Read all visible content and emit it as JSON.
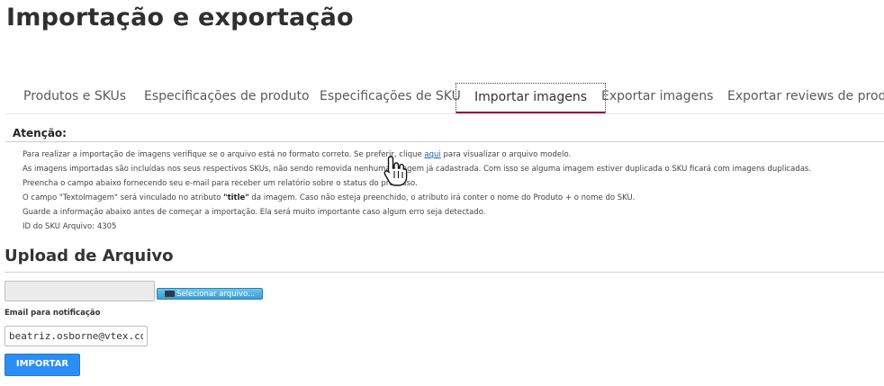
{
  "page": {
    "title": "Importação e exportação"
  },
  "tabs": [
    {
      "label": "Produtos e SKUs"
    },
    {
      "label": "Especificações de produto"
    },
    {
      "label": "Especificações de SKU"
    },
    {
      "label": "Importar imagens",
      "active": true
    },
    {
      "label": "Exportar imagens"
    },
    {
      "label": "Exportar reviews de produto"
    }
  ],
  "attention": {
    "title": "Atenção:",
    "line1_before": "Para realizar a importação de imagens verifique se o arquivo está no formato correto. Se preferir, clique ",
    "line1_link": "aqui",
    "line1_after": " para visualizar o arquivo modelo.",
    "line2": "As imagens importadas são incluídas nos seus respectivos SKUs, não sendo removida nenhuma imagem já cadastrada. Com isso se alguma imagem estiver duplicada o SKU ficará com imagens duplicadas.",
    "line3": "Preencha o campo abaixo fornecendo seu e-mail para receber um relatório sobre o status do processo.",
    "line4_before": "O campo \"TextoImagem\" será vinculado no atributo ",
    "line4_bold": "\"title\"",
    "line4_after": " da imagem. Caso não esteja preenchido, o atributo irá conter o nome do Produto + o nome do SKU.",
    "line5": "Guarde a informação abaixo antes de começar a importação. Ela será muito importante caso algum erro seja detectado.",
    "line6": "ID do SKU Arquivo: 4305"
  },
  "upload": {
    "title": "Upload de Arquivo",
    "select_button": "Selecionar arquivo...",
    "email_label": "Email para notificação",
    "email_value": "beatriz.osborne@vtex.com.b",
    "import_button": "IMPORTAR"
  },
  "colors": {
    "active_tab_underline": "#8b1a3a",
    "link": "#1a5eb8",
    "import_button": "#2a8ef5"
  },
  "icons": {
    "select_button": "folder-icon",
    "cursor": "hand-pointer-icon"
  }
}
